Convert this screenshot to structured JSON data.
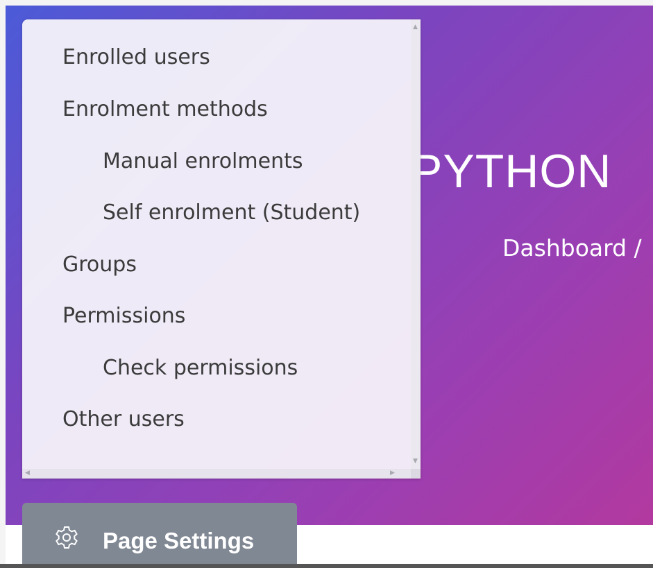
{
  "header": {
    "course_title": "PYTHON",
    "breadcrumb": "Dashboard /"
  },
  "menu": {
    "items": [
      {
        "label": "Enrolled users"
      },
      {
        "label": "Enrolment methods"
      },
      {
        "label": "Manual enrolments"
      },
      {
        "label": "Self enrolment (Student)"
      },
      {
        "label": "Groups"
      },
      {
        "label": "Permissions"
      },
      {
        "label": "Check permissions"
      },
      {
        "label": "Other users"
      }
    ]
  },
  "settings_button": {
    "label": "Page Settings",
    "icon": "gear-icon"
  },
  "colors": {
    "hero_gradient_start": "#4b5bd8",
    "hero_gradient_end": "#b2399f",
    "button_bg": "#808894",
    "menu_text": "#3b3b3b"
  }
}
